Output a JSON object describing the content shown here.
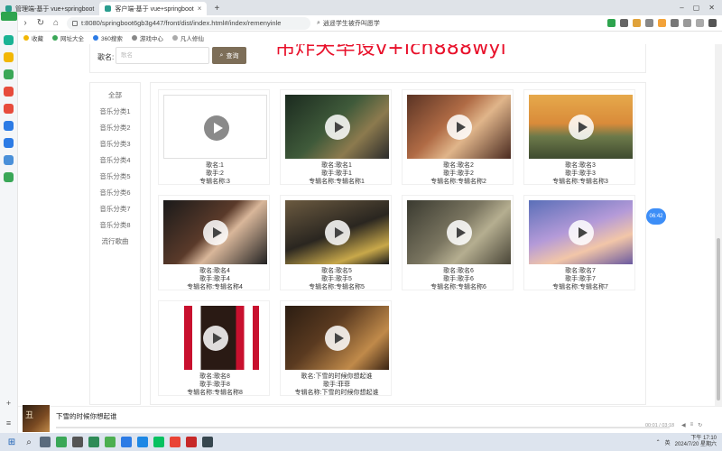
{
  "browser": {
    "tabs": [
      {
        "label": "管理端-基于 vue+springboot"
      },
      {
        "label": "客户端-基于 vue+springboot"
      }
    ],
    "url": "t:8080/springboot6gb3g447/front/dist/index.html#/index/remenyinle",
    "search_hint": "逍遥学生被乔叫愿学",
    "bookmarks": [
      "收藏",
      "网址大全",
      "360搜索",
      "游戏中心",
      "凡人修仙"
    ]
  },
  "watermark": "吊炸天毕设v+lch888wyl",
  "search": {
    "label": "歌名:",
    "placeholder": "歌名",
    "button": "查询"
  },
  "categories": [
    "全部",
    "音乐分类1",
    "音乐分类2",
    "音乐分类3",
    "音乐分类4",
    "音乐分类5",
    "音乐分类6",
    "音乐分类7",
    "音乐分类8",
    "流行歌曲"
  ],
  "songs": [
    {
      "name": "歌名:1",
      "singer": "歌手:2",
      "album": "专辑名称:3"
    },
    {
      "name": "歌名:歌名1",
      "singer": "歌手:歌手1",
      "album": "专辑名称:专辑名称1"
    },
    {
      "name": "歌名:歌名2",
      "singer": "歌手:歌手2",
      "album": "专辑名称:专辑名称2"
    },
    {
      "name": "歌名:歌名3",
      "singer": "歌手:歌手3",
      "album": "专辑名称:专辑名称3"
    },
    {
      "name": "歌名:歌名4",
      "singer": "歌手:歌手4",
      "album": "专辑名称:专辑名称4"
    },
    {
      "name": "歌名:歌名5",
      "singer": "歌手:歌手5",
      "album": "专辑名称:专辑名称5"
    },
    {
      "name": "歌名:歌名6",
      "singer": "歌手:歌手6",
      "album": "专辑名称:专辑名称6"
    },
    {
      "name": "歌名:歌名7",
      "singer": "歌手:歌手7",
      "album": "专辑名称:专辑名称7"
    },
    {
      "name": "歌名:歌名8",
      "singer": "歌手:歌手8",
      "album": "专辑名称:专辑名称8"
    },
    {
      "name": "歌名:下雪的时候你想起谁",
      "singer": "歌手:菲菲",
      "album": "专辑名称:下雪的时候你想起谁"
    }
  ],
  "time_bubble": "06:42",
  "player": {
    "title": "下雪的时候你想起谁",
    "time": "00:01 / 03:18"
  },
  "taskbar": {
    "lang": "英",
    "time": "下午 17:10",
    "date": "2024/7/20 星期六"
  }
}
